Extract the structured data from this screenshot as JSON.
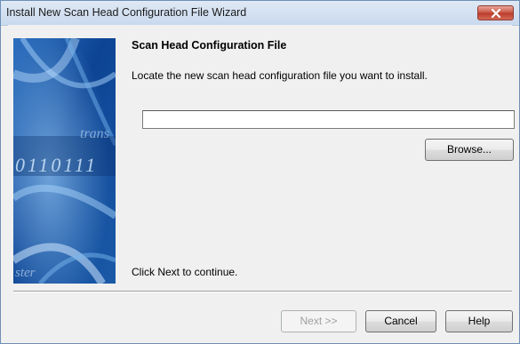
{
  "window": {
    "title": "Install New Scan Head Configuration File Wizard",
    "close_icon": "close-icon"
  },
  "banner": {
    "image": "wizard-banner-graphic",
    "binary_text": "0110111",
    "word_text": "trans",
    "lower_text": "ster"
  },
  "main": {
    "heading": "Scan Head Configuration File",
    "description": "Locate the new scan head configuration file you want to install.",
    "file_path": {
      "value": "",
      "placeholder": ""
    },
    "browse_label": "Browse...",
    "hint": "Click Next to continue."
  },
  "footer": {
    "next_label": "Next >>",
    "cancel_label": "Cancel",
    "help_label": "Help"
  },
  "colors": {
    "banner_dark": "#0b3f8a",
    "banner_light": "#5aa0e0",
    "close_red": "#c85442"
  }
}
